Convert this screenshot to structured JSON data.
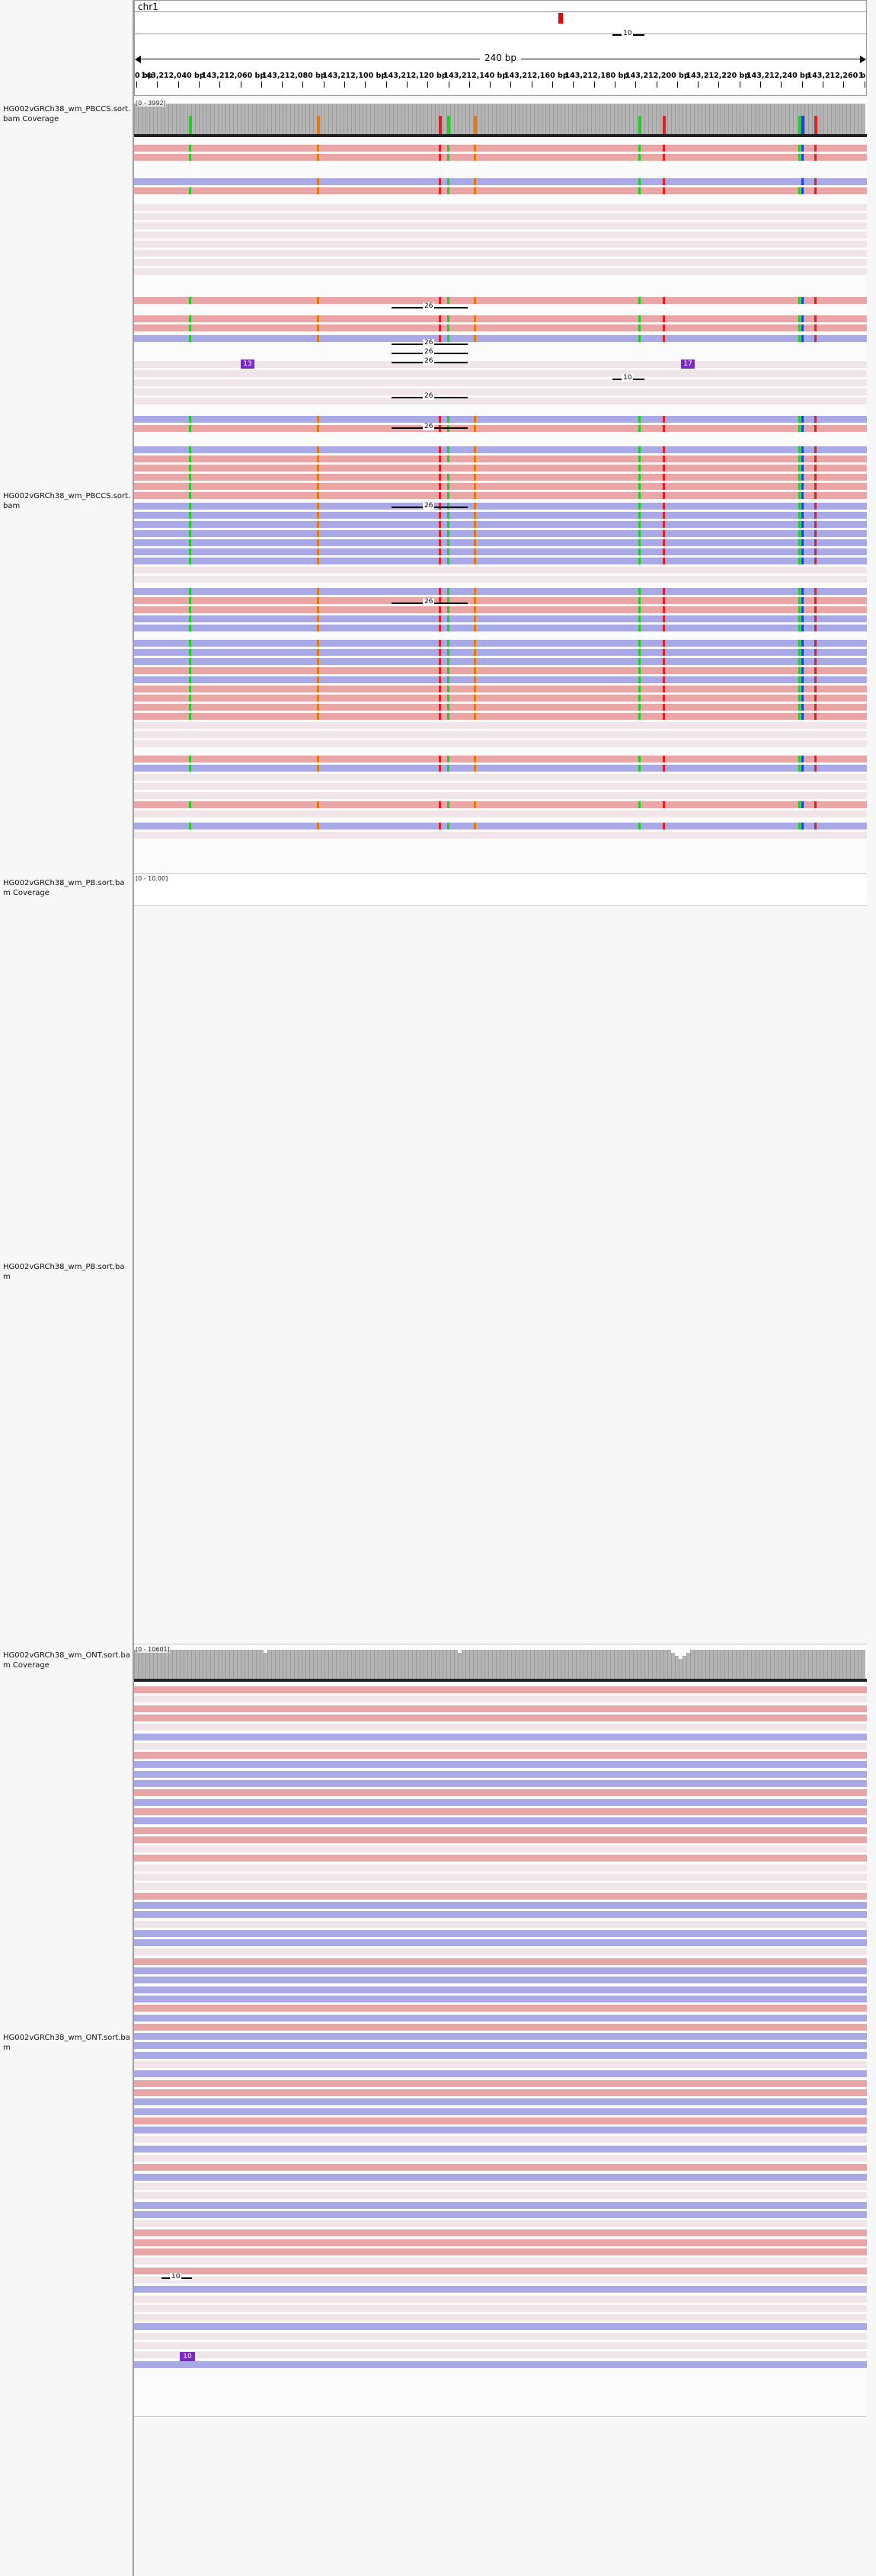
{
  "locus": {
    "chromosome": "chr1",
    "span_label": "240 bp",
    "tick_labels": [
      "0 bp",
      "143,212,040 bp",
      "143,212,060 bp",
      "143,212,080 bp",
      "143,212,100 bp",
      "143,212,120 bp",
      "143,212,140 bp",
      "143,212,160 bp",
      "143,212,180 bp",
      "143,212,200 bp",
      "143,212,220 bp",
      "143,212,240 bp",
      "143,212,260 bp",
      "1"
    ]
  },
  "tracks": [
    {
      "id": "pbccs-coverage",
      "label": "HG002vGRCh38_wm_PBCCS.sort.bam Coverage",
      "range": "[0 - 3992]"
    },
    {
      "id": "pbccs",
      "label": "HG002vGRCh38_wm_PBCCS.sort.bam"
    },
    {
      "id": "pb-coverage",
      "label": "HG002vGRCh38_wm_PB.sort.bam Coverage",
      "range": "[0 - 10.00]"
    },
    {
      "id": "pb",
      "label": "HG002vGRCh38_wm_PB.sort.bam"
    },
    {
      "id": "ont-coverage",
      "label": "HG002vGRCh38_wm_ONT.sort.bam Coverage",
      "range": "[0 - 10601]"
    },
    {
      "id": "ont",
      "label": "HG002vGRCh38_wm_ONT.sort.bam"
    }
  ],
  "annotations": {
    "pbccs_insertions": [
      "13",
      "17"
    ],
    "pbccs_deletions": [
      "10",
      "26",
      "26",
      "26",
      "26",
      "10",
      "26",
      "26",
      "26",
      "26"
    ],
    "ont_deletion": "10",
    "ont_insertion": "10"
  },
  "colors": {
    "forward_read": "#e9a6a6",
    "reverse_read": "#a9a9e6",
    "mismatch_A": "#22cc22",
    "mismatch_C": "#1f3fe0",
    "mismatch_G": "#e07a10",
    "mismatch_T": "#e02020",
    "insertion": "#7a2ac1"
  }
}
